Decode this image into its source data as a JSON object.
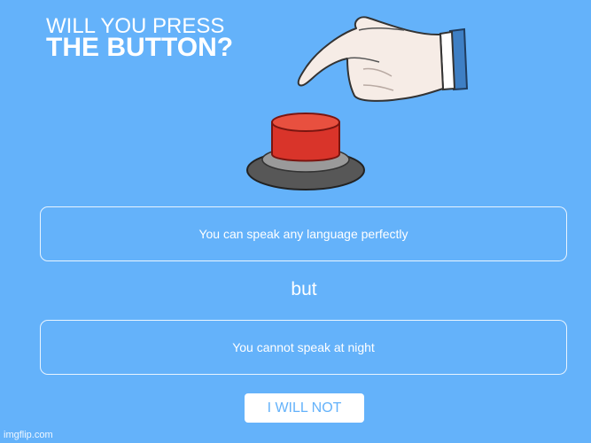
{
  "header": {
    "line1": "WILL YOU PRESS",
    "line2": "THE BUTTON?"
  },
  "options": {
    "first": "You can speak any language perfectly",
    "connector": "but",
    "second": "You cannot speak at night"
  },
  "action": {
    "label": "I WILL NOT"
  },
  "watermark": "imgflip.com",
  "colors": {
    "background": "#64b2fa",
    "button_red": "#d9342a",
    "button_base": "#575757",
    "sleeve_blue": "#3e7fc4"
  }
}
